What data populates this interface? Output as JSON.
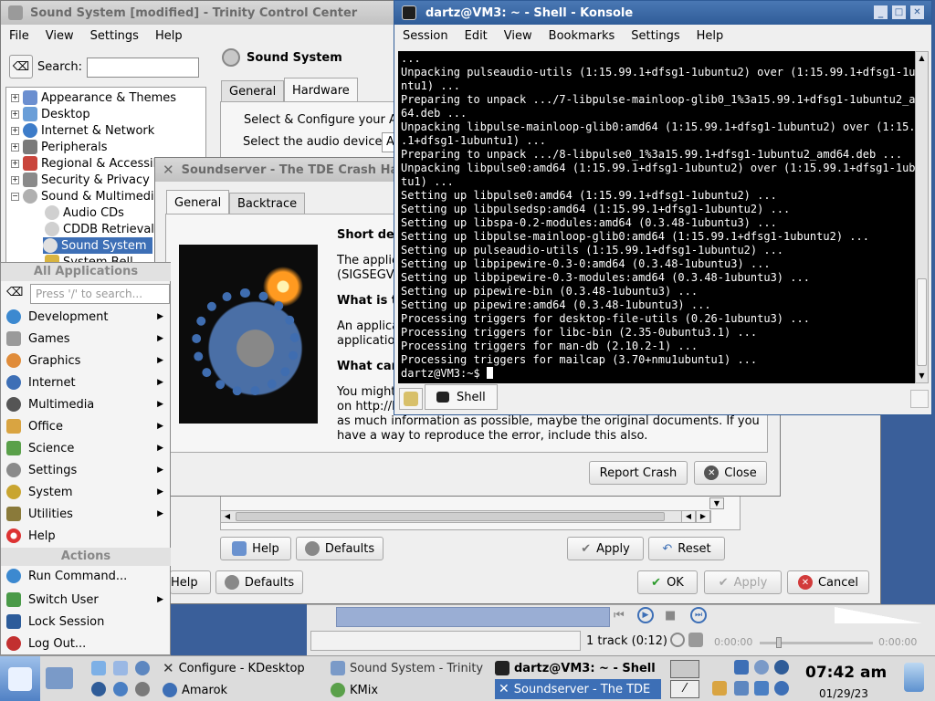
{
  "tcc": {
    "title": "Sound System [modified] - Trinity Control Center",
    "menu": [
      "File",
      "View",
      "Settings",
      "Help"
    ],
    "search_label": "Search:",
    "search_value": "",
    "heading": "Sound System",
    "tabs": [
      "General",
      "Hardware"
    ],
    "group_title": "Select & Configure your Au",
    "device_label": "Select the audio device:",
    "device_value": "A",
    "tree": [
      "Appearance & Themes",
      "Desktop",
      "Internet & Network",
      "Peripherals",
      "Regional & Accessibi",
      "Security & Privacy",
      "Sound & Multimedia",
      "Audio CDs",
      "CDDB Retrieval",
      "Sound System",
      "System Bell"
    ],
    "inner_buttons": {
      "help": "Help",
      "defaults": "Defaults",
      "apply": "Apply",
      "reset": "Reset"
    },
    "outer_buttons": {
      "help": "Help",
      "defaults": "Defaults",
      "ok": "OK",
      "apply": "Apply",
      "cancel": "Cancel"
    }
  },
  "crash": {
    "title": "Soundserver - The TDE Crash Handl",
    "tabs": [
      "General",
      "Backtrace"
    ],
    "short_desc": "Short des",
    "p1a": "The applic",
    "p1b": "(SIGSEGV)",
    "what_is": "What is t",
    "p2a": "An applica",
    "p2b": "application",
    "what_can": "What can",
    "p3a": "You might",
    "p3b": "on http://b",
    "p3c": "as much information as possible, maybe the original documents. If you",
    "p3d": "have a way to reproduce the error, include this also.",
    "report_button": "Report Crash",
    "close_button": "Close"
  },
  "konsole": {
    "title": "dartz@VM3: ~ - Shell - Konsole",
    "menu": [
      "Session",
      "Edit",
      "View",
      "Bookmarks",
      "Settings",
      "Help"
    ],
    "lines": [
      "...",
      "Unpacking pulseaudio-utils (1:15.99.1+dfsg1-1ubuntu2) over (1:15.99.1+dfsg1-1ubu",
      "ntu1) ...",
      "Preparing to unpack .../7-libpulse-mainloop-glib0_1%3a15.99.1+dfsg1-1ubuntu2_amd",
      "64.deb ...",
      "Unpacking libpulse-mainloop-glib0:amd64 (1:15.99.1+dfsg1-1ubuntu2) over (1:15.99",
      ".1+dfsg1-1ubuntu1) ...",
      "Preparing to unpack .../8-libpulse0_1%3a15.99.1+dfsg1-1ubuntu2_amd64.deb ...",
      "Unpacking libpulse0:amd64 (1:15.99.1+dfsg1-1ubuntu2) over (1:15.99.1+dfsg1-1ubun",
      "tu1) ...",
      "Setting up libpulse0:amd64 (1:15.99.1+dfsg1-1ubuntu2) ...",
      "Setting up libpulsedsp:amd64 (1:15.99.1+dfsg1-1ubuntu2) ...",
      "Setting up libspa-0.2-modules:amd64 (0.3.48-1ubuntu3) ...",
      "Setting up libpulse-mainloop-glib0:amd64 (1:15.99.1+dfsg1-1ubuntu2) ...",
      "Setting up pulseaudio-utils (1:15.99.1+dfsg1-1ubuntu2) ...",
      "Setting up libpipewire-0.3-0:amd64 (0.3.48-1ubuntu3) ...",
      "Setting up libpipewire-0.3-modules:amd64 (0.3.48-1ubuntu3) ...",
      "Setting up pipewire-bin (0.3.48-1ubuntu3) ...",
      "Setting up pipewire:amd64 (0.3.48-1ubuntu3) ...",
      "Processing triggers for desktop-file-utils (0.26-1ubuntu3) ...",
      "Processing triggers for libc-bin (2.35-0ubuntu3.1) ...",
      "Processing triggers for man-db (2.10.2-1) ...",
      "Processing triggers for mailcap (3.70+nmu1ubuntu1) ...",
      "dartz@VM3:~$ "
    ],
    "tab_label": "Shell"
  },
  "kmenu": {
    "header": "All Applications",
    "search_placeholder": "Press '/' to search...",
    "apps": [
      "Development",
      "Games",
      "Graphics",
      "Internet",
      "Multimedia",
      "Office",
      "Science",
      "Settings",
      "System",
      "Utilities",
      "Help"
    ],
    "actions_header": "Actions",
    "actions": [
      "Run Command...",
      "Switch User",
      "Lock Session",
      "Log Out..."
    ]
  },
  "amarok": {
    "track_info": "1 track (0:12)",
    "time_left": "0:00:00",
    "time_right": "0:00:00"
  },
  "taskbar": {
    "tasks": [
      "Configure - KDesktop",
      "Sound System - Trinity",
      "dartz@VM3: ~ - Shell -",
      "Amarok",
      "KMix",
      "Soundserver - The TDE"
    ],
    "clock": "07:42 am",
    "date": "01/29/23"
  },
  "colors": {
    "titlebar_active": "#2f5c98",
    "taskbar": "#dcdcdc",
    "desktop": "#3a5f9a"
  }
}
